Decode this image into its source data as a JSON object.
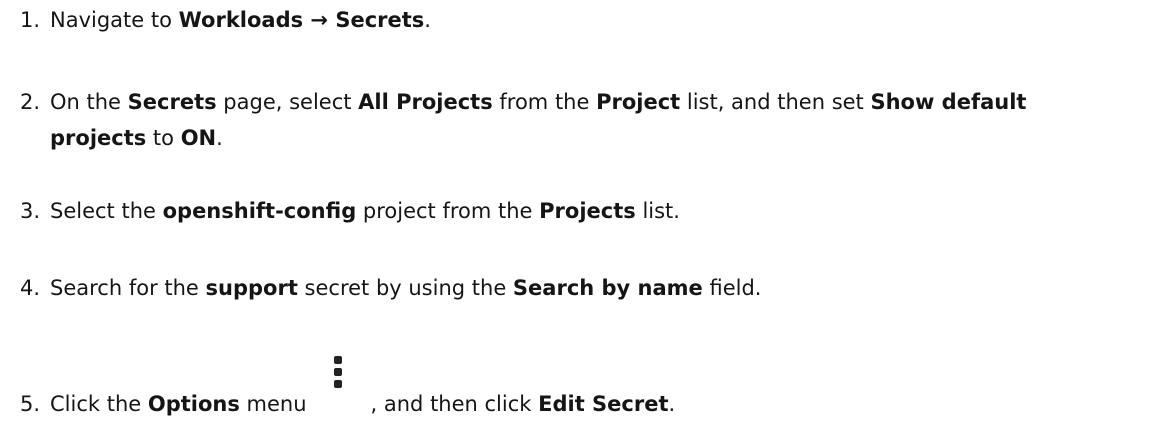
{
  "steps": [
    {
      "num": "1.",
      "t1": "Navigate to ",
      "b1": "Workloads → Secrets",
      "t2": "."
    },
    {
      "num": "2.",
      "t1": "On the ",
      "b1": "Secrets",
      "t2": " page, select ",
      "b2": "All Projects",
      "t3": " from the ",
      "b3": "Project",
      "t4": " list, and then set ",
      "b4": "Show default",
      "b5": "projects",
      "t5": " to ",
      "b6": "ON",
      "t6": "."
    },
    {
      "num": "3.",
      "t1": "Select the ",
      "b1": "openshift-config",
      "t2": " project from the ",
      "b2": "Projects",
      "t3": " list."
    },
    {
      "num": "4.",
      "t1": "Search for the ",
      "b1": "support",
      "t2": " secret by using the ",
      "b2": "Search by name",
      "t3": " field."
    },
    {
      "num": "5.",
      "t1": "Click the ",
      "b1": "Options",
      "t2": " menu",
      "icon": "kebab-options-icon",
      "t3": ", and then click ",
      "b2": "Edit Secret",
      "t4": "."
    }
  ]
}
